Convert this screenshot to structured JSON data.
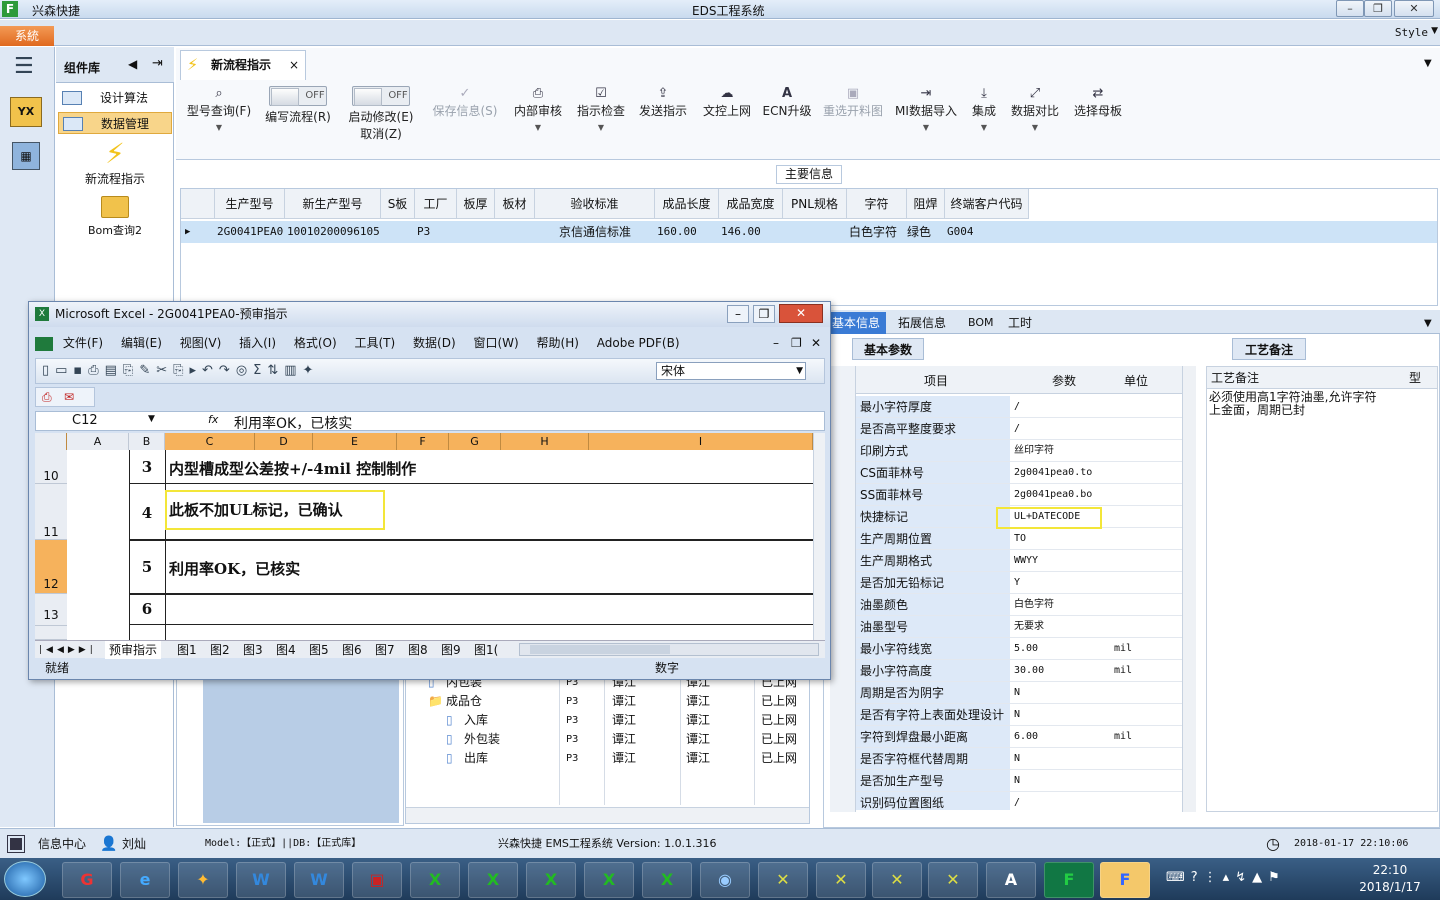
{
  "app": {
    "title": "EDS工程系统",
    "title_left": "兴森快捷",
    "system_btn": "系統",
    "style_label": "Style"
  },
  "component_panel": {
    "title": "组件库",
    "items": [
      "设计算法",
      "数据管理"
    ],
    "big_items": [
      "新流程指示",
      "Bom查询2"
    ]
  },
  "doc_tab": {
    "label": "新流程指示"
  },
  "ribbon": {
    "buttons": [
      {
        "label": "型号查询(F)",
        "icon": "search-icon"
      },
      {
        "label": "编写流程(R)",
        "toggle": "OFF"
      },
      {
        "label": "启动修改(E)",
        "sub": "取消(Z)",
        "toggle": "OFF"
      },
      {
        "label": "保存信息(S)",
        "icon": "check-icon",
        "disabled": true
      },
      {
        "label": "内部审核",
        "icon": "print-icon"
      },
      {
        "label": "指示检查",
        "icon": "checkbox-icon"
      },
      {
        "label": "发送指示",
        "icon": "upload-icon"
      },
      {
        "label": "文控上网",
        "icon": "cloud-upload-icon"
      },
      {
        "label": "ECN升级",
        "icon": "ecn-icon"
      },
      {
        "label": "重选开料图",
        "icon": "image-icon",
        "disabled": true
      },
      {
        "label": "MI数据导入",
        "icon": "import-icon"
      },
      {
        "label": "集成",
        "icon": "download-icon"
      },
      {
        "label": "数据对比",
        "icon": "compare-icon"
      },
      {
        "label": "选择母板",
        "icon": "shuffle-icon"
      }
    ]
  },
  "main_info": {
    "section_label": "主要信息",
    "columns": [
      "生产型号",
      "新生产型号",
      "S板",
      "工厂",
      "板厚",
      "板材",
      "验收标准",
      "成品长度",
      "成品宽度",
      "PNL规格",
      "字符",
      "阻焊",
      "终端客户代码"
    ],
    "row": [
      "2G0041PEA0",
      "10010200096105",
      "",
      "P3",
      "",
      "",
      "京信通信标准",
      "160.00",
      "146.00",
      "",
      "白色字符",
      "绿色",
      "G004"
    ]
  },
  "right_panel": {
    "tabs": [
      "基本信息",
      "拓展信息",
      "BOM",
      "工时"
    ],
    "subtab": "基本参数",
    "note_tab": "工艺备注",
    "note_header": "工艺备注",
    "note_extra": "型",
    "note_text": "必须使用高1字符油墨,允许字符上金面，周期已封",
    "headers": [
      "项目",
      "参数",
      "单位"
    ],
    "rows": [
      {
        "k": "最小字符厚度",
        "v": "/",
        "u": ""
      },
      {
        "k": "是否高平整度要求",
        "v": "/",
        "u": ""
      },
      {
        "k": "印刷方式",
        "v": "丝印字符",
        "u": ""
      },
      {
        "k": "CS面菲林号",
        "v": "2g0041pea0.to",
        "u": ""
      },
      {
        "k": "SS面菲林号",
        "v": "2g0041pea0.bo",
        "u": ""
      },
      {
        "k": "快捷标记",
        "v": "UL+DATECODE",
        "u": ""
      },
      {
        "k": "生产周期位置",
        "v": "TO",
        "u": ""
      },
      {
        "k": "生产周期格式",
        "v": "WWYY",
        "u": ""
      },
      {
        "k": "是否加无铅标记",
        "v": "Y",
        "u": ""
      },
      {
        "k": "油墨颜色",
        "v": "白色字符",
        "u": ""
      },
      {
        "k": "油墨型号",
        "v": "无要求",
        "u": ""
      },
      {
        "k": "最小字符线宽",
        "v": "5.00",
        "u": "mil"
      },
      {
        "k": "最小字符高度",
        "v": "30.00",
        "u": "mil"
      },
      {
        "k": "周期是否为阴字",
        "v": "N",
        "u": ""
      },
      {
        "k": "是否有字符上表面处理设计",
        "v": "N",
        "u": ""
      },
      {
        "k": "字符到焊盘最小距离",
        "v": "6.00",
        "u": "mil"
      },
      {
        "k": "是否字符框代替周期",
        "v": "N",
        "u": ""
      },
      {
        "k": "是否加生产型号",
        "v": "N",
        "u": ""
      },
      {
        "k": "识别码位置图纸",
        "v": "/",
        "u": ""
      }
    ]
  },
  "tree": {
    "rows": [
      {
        "name": "内包装",
        "f": "P3",
        "a": "谭江",
        "b": "谭江",
        "s": "已上网"
      },
      {
        "name": "成品仓",
        "f": "P3",
        "a": "谭江",
        "b": "谭江",
        "s": "已上网"
      },
      {
        "name": "入库",
        "f": "P3",
        "a": "谭江",
        "b": "谭江",
        "s": "已上网"
      },
      {
        "name": "外包装",
        "f": "P3",
        "a": "谭江",
        "b": "谭江",
        "s": "已上网"
      },
      {
        "name": "出库",
        "f": "P3",
        "a": "谭江",
        "b": "谭江",
        "s": "已上网"
      }
    ]
  },
  "excel": {
    "title": "Microsoft Excel - 2G0041PEA0-预审指示",
    "menus": [
      "文件(F)",
      "编辑(E)",
      "视图(V)",
      "插入(I)",
      "格式(O)",
      "工具(T)",
      "数据(D)",
      "窗口(W)",
      "帮助(H)",
      "Adobe PDF(B)"
    ],
    "font": "宋体",
    "cell_ref": "C12",
    "fx": "fx",
    "formula": "利用率OK，已核实",
    "columns": [
      "A",
      "B",
      "C",
      "D",
      "E",
      "F",
      "G",
      "H",
      "I"
    ],
    "rows": [
      {
        "num": "10",
        "b": "3",
        "c": "内型槽成型公差按+/-4mil 控制制作"
      },
      {
        "num": "11",
        "b": "4",
        "c": "此板不加UL标记，已确认"
      },
      {
        "num": "12",
        "b": "5",
        "c": "利用率OK，已核实"
      },
      {
        "num": "13",
        "b": "6",
        "c": ""
      }
    ],
    "sheet_tabs": [
      "预审指示",
      "图1",
      "图2",
      "图3",
      "图4",
      "图5",
      "图6",
      "图7",
      "图8",
      "图9",
      "图1("
    ],
    "status": "就绪",
    "status_right": "数字"
  },
  "statusbar": {
    "info_center": "信息中心",
    "user": "刘灿",
    "model": "Model:【正式】||DB:【正式库】",
    "version": "兴森快捷 EMS工程系统 Version: 1.0.1.316",
    "datetime": "2018-01-17 22:10:06"
  },
  "taskbar": {
    "time": "22:10",
    "date": "2018/1/17"
  }
}
